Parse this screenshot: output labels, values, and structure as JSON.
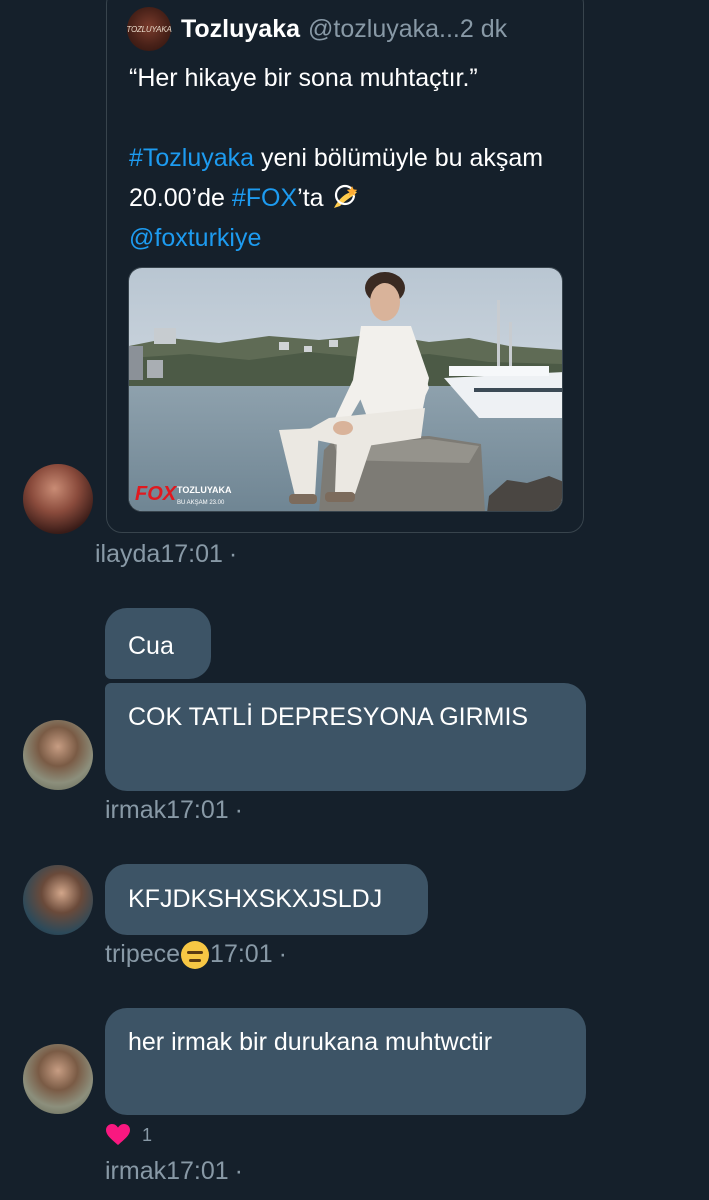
{
  "quoted_tweet": {
    "avatar_text": "TOZLUYAKA",
    "name": "Tozluyaka",
    "handle": "@tozluyaka...",
    "time": "2 dk",
    "quote": "“Her hikaye bir sona muhtaçtır.”",
    "hashtag_show": "#Tozluyaka",
    "text_part1": " yeni bölümüyle bu akşam 20.00’de ",
    "hashtag_channel": "#FOX",
    "text_part2": "’ta",
    "mention": "@foxturkiye",
    "media": {
      "logo": "FOX",
      "show_title": "TOZLUYAKA",
      "show_time": "BU AKŞAM 23.00"
    }
  },
  "messages": [
    {
      "sender": "ilayda",
      "time": "17:01",
      "separator": "·"
    },
    {
      "sender": "irmak",
      "bubbles": [
        "Cua",
        "COK TATLİ DEPRESYONA GIRMIS"
      ],
      "time": "17:01",
      "separator": "·"
    },
    {
      "sender": "tripece",
      "bubbles": [
        "KFJDKSHXSKXJSLDJ"
      ],
      "time": "17:01",
      "separator": "·"
    },
    {
      "sender": "irmak",
      "bubbles": [
        "her irmak bir durukana muhtwctir"
      ],
      "reaction_count": "1",
      "time": "17:01",
      "separator": "·"
    }
  ],
  "colors": {
    "background": "#15202b",
    "bubble": "#3d5466",
    "link": "#1d9bf0",
    "muted": "#8899a6",
    "heart": "#f91880"
  }
}
